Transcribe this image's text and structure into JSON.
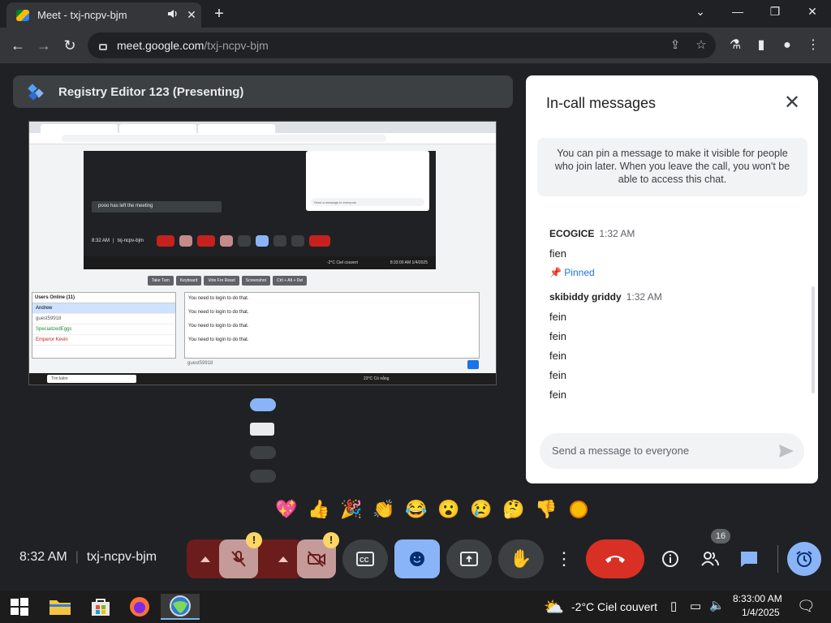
{
  "browser": {
    "tab_title": "Meet - txj-ncpv-bjm",
    "url_host": "meet.google.com",
    "url_path": "/txj-ncpv-bjm"
  },
  "meet": {
    "presenting_title": "Registry Editor 123 (Presenting)",
    "clock": "8:32 AM",
    "meeting_code": "txj-ncpv-bjm",
    "participant_count": "16",
    "reactions": [
      "💖",
      "👍",
      "🎉",
      "👏",
      "😂",
      "😮",
      "😢",
      "🤔",
      "👎"
    ],
    "accent_red": "#d93025",
    "accent_blue": "#8ab4f8"
  },
  "shared_screen": {
    "remote_notice": "pooo has left the meeting",
    "remote_clock": "8:32 AM",
    "remote_code": "txj-ncpv-bjm",
    "remote_tray": "-2°C Ciel couvert",
    "remote_datetime": "8:33:00 AM 1/4/2025",
    "remote_chat_placeholder": "Send a message to everyone",
    "buttons": [
      "Take Turn",
      "Keyboard",
      "Vote For Reset",
      "Screenshot",
      "Ctrl + Alt + Del"
    ],
    "users_header": "Users Online (11)",
    "users": [
      {
        "name": "Andrew",
        "color": "#222222",
        "highlight": true
      },
      {
        "name": "guest59918",
        "color": "#555555",
        "highlight": false
      },
      {
        "name": "SpecializedEggs",
        "color": "#1e8e3e",
        "highlight": false
      },
      {
        "name": "Emperor Kevin",
        "color": "#c5221f",
        "highlight": false
      }
    ],
    "chat_lines": [
      "You need to login to do that.",
      "You need to login to do that.",
      "You need to login to do that.",
      "You need to login to do that."
    ],
    "chat_name": "guest59918",
    "taskbar_search": "Tìm kiếm",
    "taskbar_weather": "23°C Có nắng"
  },
  "chat": {
    "title": "In-call messages",
    "info": "You can pin a message to make it visible for people who join later. When you leave the call, you won't be able to access this chat.",
    "groups": [
      {
        "sender": "ECOGICE",
        "time": "1:32 AM",
        "messages": [
          "fien"
        ],
        "pinned": "Pinned"
      },
      {
        "sender": "skibiddy griddy",
        "time": "1:32 AM",
        "messages": [
          "fein",
          "fein",
          "fein",
          "fein",
          "fein"
        ],
        "pinned": ""
      }
    ],
    "input_placeholder": "Send a message to everyone"
  },
  "taskbar": {
    "weather": "-2°C  Ciel couvert",
    "time": "8:33:00 AM",
    "date": "1/4/2025"
  }
}
